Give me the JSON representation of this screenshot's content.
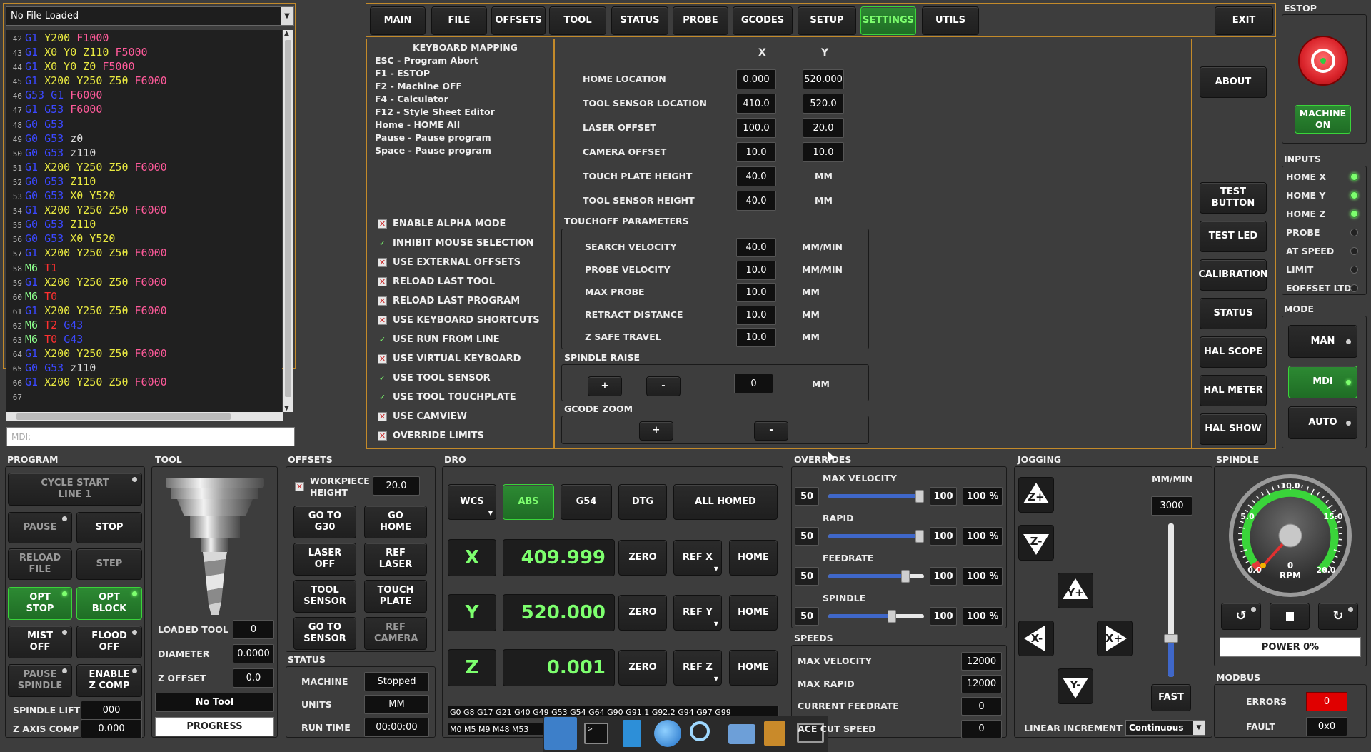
{
  "file": {
    "name": "No File Loaded",
    "mdi_placeholder": "MDI:"
  },
  "gcode": [
    {
      "n": "42",
      "t": [
        [
          "G1",
          "B"
        ],
        [
          " Y200 ",
          "Y"
        ],
        [
          "F1000",
          "P"
        ]
      ]
    },
    {
      "n": "43",
      "t": [
        [
          "G1",
          "B"
        ],
        [
          " X0 Y0 Z110 ",
          "Y"
        ],
        [
          "F5000",
          "P"
        ]
      ]
    },
    {
      "n": "44",
      "t": [
        [
          "G1",
          "B"
        ],
        [
          " X0 Y0 Z0 ",
          "Y"
        ],
        [
          "F5000",
          "P"
        ]
      ]
    },
    {
      "n": "45",
      "t": [
        [
          "G1",
          "B"
        ],
        [
          " X200 Y250 Z50 ",
          "Y"
        ],
        [
          "F6000",
          "P"
        ]
      ]
    },
    {
      "n": "46",
      "t": [
        [
          "G53 G1",
          "B"
        ],
        [
          " ",
          "W"
        ],
        [
          "F6000",
          "P"
        ]
      ]
    },
    {
      "n": "47",
      "t": [
        [
          "G1 G53",
          "B"
        ],
        [
          " ",
          "W"
        ],
        [
          "F6000",
          "P"
        ]
      ]
    },
    {
      "n": "48",
      "t": [
        [
          "G0 G53",
          "B"
        ]
      ]
    },
    {
      "n": "49",
      "t": [
        [
          "G0 G53",
          "B"
        ],
        [
          " z0",
          "W"
        ]
      ]
    },
    {
      "n": "50",
      "t": [
        [
          "G0 G53",
          "B"
        ],
        [
          " z110",
          "W"
        ]
      ]
    },
    {
      "n": "51",
      "t": [
        [
          "G1",
          "B"
        ],
        [
          " X200 Y250 Z50 ",
          "Y"
        ],
        [
          "F6000",
          "P"
        ]
      ]
    },
    {
      "n": "52",
      "t": [
        [
          "G0 G53",
          "B"
        ],
        [
          " Z110",
          "Y"
        ]
      ]
    },
    {
      "n": "53",
      "t": [
        [
          "G0 G53",
          "B"
        ],
        [
          " X0 Y520",
          "Y"
        ]
      ]
    },
    {
      "n": "54",
      "t": [
        [
          "G1",
          "B"
        ],
        [
          " X200 Y250 Z50 ",
          "Y"
        ],
        [
          "F6000",
          "P"
        ]
      ]
    },
    {
      "n": "55",
      "t": [
        [
          "G0 G53",
          "B"
        ],
        [
          " Z110",
          "Y"
        ]
      ]
    },
    {
      "n": "56",
      "t": [
        [
          "G0 G53",
          "B"
        ],
        [
          " X0 Y520",
          "Y"
        ]
      ]
    },
    {
      "n": "57",
      "t": [
        [
          "G1",
          "B"
        ],
        [
          " X200 Y250 Z50 ",
          "Y"
        ],
        [
          "F6000",
          "P"
        ]
      ]
    },
    {
      "n": "58",
      "t": [
        [
          "M6",
          "G"
        ],
        [
          " T1",
          "R"
        ]
      ]
    },
    {
      "n": "59",
      "t": [
        [
          "G1",
          "B"
        ],
        [
          " X200 Y250 Z50 ",
          "Y"
        ],
        [
          "F6000",
          "P"
        ]
      ]
    },
    {
      "n": "60",
      "t": [
        [
          "M6",
          "G"
        ],
        [
          " T0",
          "R"
        ]
      ]
    },
    {
      "n": "61",
      "t": [
        [
          "G1",
          "B"
        ],
        [
          " X200 Y250 Z50 ",
          "Y"
        ],
        [
          "F6000",
          "P"
        ]
      ]
    },
    {
      "n": "62",
      "t": [
        [
          "M6",
          "G"
        ],
        [
          " T2 ",
          "R"
        ],
        [
          "G43",
          "B"
        ]
      ]
    },
    {
      "n": "63",
      "t": [
        [
          "M6",
          "G"
        ],
        [
          " T0 ",
          "R"
        ],
        [
          "G43",
          "B"
        ]
      ]
    },
    {
      "n": "64",
      "t": [
        [
          "G1",
          "B"
        ],
        [
          " X200 Y250 Z50 ",
          "Y"
        ],
        [
          "F6000",
          "P"
        ]
      ]
    },
    {
      "n": "65",
      "t": [
        [
          "G0 G53",
          "B"
        ],
        [
          " z110",
          "W"
        ]
      ]
    },
    {
      "n": "66",
      "t": [
        [
          "G1",
          "B"
        ],
        [
          " X200 Y250 Z50 ",
          "Y"
        ],
        [
          "F6000",
          "P"
        ]
      ]
    },
    {
      "n": "67",
      "t": []
    }
  ],
  "tabs": [
    "MAIN",
    "FILE",
    "OFFSETS",
    "TOOL",
    "STATUS",
    "PROBE",
    "GCODES",
    "SETUP",
    "SETTINGS",
    "UTILS"
  ],
  "active_tab": "SETTINGS",
  "exit_label": "EXIT",
  "estop": {
    "title": "ESTOP",
    "machine_label": "MACHINE ON"
  },
  "keyboard": {
    "title": "KEYBOARD MAPPING",
    "items": [
      "ESC - Program Abort",
      "F1 - ESTOP",
      "F2 - Machine OFF",
      "F4 - Calculator",
      "F12 - Style Sheet Editor",
      "Home - HOME All",
      "Pause - Pause program",
      "Space - Pause program"
    ]
  },
  "options": [
    {
      "label": "ENABLE ALPHA MODE",
      "state": "x"
    },
    {
      "label": "INHIBIT MOUSE SELECTION",
      "state": "ok"
    },
    {
      "label": "USE EXTERNAL OFFSETS",
      "state": "x"
    },
    {
      "label": "RELOAD LAST TOOL",
      "state": "x"
    },
    {
      "label": "RELOAD LAST PROGRAM",
      "state": "x"
    },
    {
      "label": "USE KEYBOARD SHORTCUTS",
      "state": "x"
    },
    {
      "label": "USE RUN FROM LINE",
      "state": "ok"
    },
    {
      "label": "USE VIRTUAL KEYBOARD",
      "state": "x"
    },
    {
      "label": "USE TOOL SENSOR",
      "state": "ok"
    },
    {
      "label": "USE TOOL TOUCHPLATE",
      "state": "ok"
    },
    {
      "label": "USE CAMVIEW",
      "state": "x"
    },
    {
      "label": "OVERRIDE LIMITS",
      "state": "x"
    }
  ],
  "locations": {
    "x_header": "X",
    "y_header": "Y",
    "rows": [
      {
        "label": "HOME LOCATION",
        "x": "0.000",
        "y": "520.000"
      },
      {
        "label": "TOOL SENSOR LOCATION",
        "x": "410.0",
        "y": "520.0"
      },
      {
        "label": "LASER OFFSET",
        "x": "100.0",
        "y": "20.0"
      },
      {
        "label": "CAMERA OFFSET",
        "x": "10.0",
        "y": "10.0"
      },
      {
        "label": "TOUCH PLATE HEIGHT",
        "x": "40.0",
        "y": "MM"
      },
      {
        "label": "TOOL SENSOR HEIGHT",
        "x": "40.0",
        "y": "MM"
      }
    ]
  },
  "touchoff": {
    "title": "TOUCHOFF PARAMETERS",
    "rows": [
      {
        "label": "SEARCH VELOCITY",
        "value": "40.0",
        "unit": "MM/MIN"
      },
      {
        "label": "PROBE VELOCITY",
        "value": "10.0",
        "unit": "MM/MIN"
      },
      {
        "label": "MAX PROBE",
        "value": "10.0",
        "unit": "MM"
      },
      {
        "label": "RETRACT DISTANCE",
        "value": "10.0",
        "unit": "MM"
      },
      {
        "label": "Z SAFE TRAVEL",
        "value": "10.0",
        "unit": "MM"
      }
    ]
  },
  "spindle_raise": {
    "title": "SPINDLE RAISE",
    "plus": "+",
    "minus": "-",
    "value": "0",
    "unit": "MM"
  },
  "gcode_zoom": {
    "title": "GCODE ZOOM",
    "plus": "+",
    "minus": "-"
  },
  "side_buttons": [
    "ABOUT",
    "TEST BUTTON",
    "TEST LED",
    "CALIBRATION",
    "STATUS",
    "HAL SCOPE",
    "HAL METER",
    "HAL SHOW"
  ],
  "inputs": {
    "title": "INPUTS",
    "items": [
      {
        "label": "HOME X",
        "on": true
      },
      {
        "label": "HOME Y",
        "on": true
      },
      {
        "label": "HOME Z",
        "on": true
      },
      {
        "label": "PROBE",
        "on": false
      },
      {
        "label": "AT SPEED",
        "on": false
      },
      {
        "label": "LIMIT",
        "on": false
      },
      {
        "label": "EOFFSET LTD",
        "on": false
      }
    ]
  },
  "mode": {
    "title": "MODE",
    "items": [
      {
        "label": "MAN",
        "active": false
      },
      {
        "label": "MDI",
        "active": true
      },
      {
        "label": "AUTO",
        "active": false
      }
    ]
  },
  "program": {
    "title": "PROGRAM",
    "cycle_start": "CYCLE START",
    "cycle_line": "LINE 1",
    "pause": "PAUSE",
    "stop": "STOP",
    "reload": "RELOAD FILE",
    "step": "STEP",
    "opt_stop": "OPT STOP",
    "opt_block": "OPT BLOCK",
    "mist": "MIST OFF",
    "flood": "FLOOD OFF",
    "pause_spindle": "PAUSE SPINDLE",
    "enable_zcomp": "ENABLE Z COMP",
    "spindle_lift_label": "SPINDLE LIFT",
    "spindle_lift": "000",
    "zaxis_comp_label": "Z AXIS COMP",
    "zaxis_comp": "0.000"
  },
  "tool": {
    "title": "TOOL",
    "loaded_label": "LOADED TOOL",
    "loaded": "0",
    "diameter_label": "DIAMETER",
    "diameter": "0.0000",
    "zoffset_label": "Z OFFSET",
    "zoffset": "0.0",
    "name": "No Tool",
    "progress": "PROGRESS"
  },
  "offsets": {
    "title": "OFFSETS",
    "wp_label": "WORKPIECE HEIGHT",
    "wp": "20.0",
    "b1": "GO TO G30",
    "b2": "GO HOME",
    "b3": "LASER OFF",
    "b4": "REF LASER",
    "b5": "TOOL SENSOR",
    "b6": "TOUCH PLATE",
    "b7": "GO TO SENSOR",
    "b8": "REF CAMERA"
  },
  "status": {
    "title": "STATUS",
    "machine_label": "MACHINE",
    "machine": "Stopped",
    "units_label": "UNITS",
    "units": "MM",
    "runtime_label": "RUN TIME",
    "runtime": "00:00:00"
  },
  "dro": {
    "title": "DRO",
    "wcs": "WCS",
    "abs": "ABS",
    "g54": "G54",
    "dtg": "DTG",
    "all_homed": "ALL HOMED",
    "axes": [
      {
        "axis": "X",
        "value": "409.999",
        "ref": "REF X"
      },
      {
        "axis": "Y",
        "value": "520.000",
        "ref": "REF Y"
      },
      {
        "axis": "Z",
        "value": "0.001",
        "ref": "REF Z"
      }
    ],
    "zero": "ZERO",
    "home": "HOME",
    "gcodes_active": "G0 G8 G17 G21 G40 G49 G53 G54 G64 G90 G91.1 G92.2 G94 G97 G99",
    "mcodes_active": "M0 M5 M9 M48 M53"
  },
  "overrides": {
    "title": "OVERRIDES",
    "items": [
      {
        "label": "MAX VELOCITY",
        "min": "50",
        "max": "100",
        "pct": "100 %",
        "frac": 1.0
      },
      {
        "label": "RAPID",
        "min": "50",
        "max": "100",
        "pct": "100 %",
        "frac": 1.0
      },
      {
        "label": "FEEDRATE",
        "min": "50",
        "max": "100",
        "pct": "100 %",
        "frac": 0.84
      },
      {
        "label": "SPINDLE",
        "min": "50",
        "max": "100",
        "pct": "100 %",
        "frac": 0.68
      }
    ]
  },
  "speeds": {
    "title": "SPEEDS",
    "items": [
      {
        "label": "MAX VELOCITY",
        "value": "12000"
      },
      {
        "label": "MAX RAPID",
        "value": "12000"
      },
      {
        "label": "CURRENT FEEDRATE",
        "value": "0"
      },
      {
        "label": "ACE CUT SPEED",
        "value": "0"
      }
    ]
  },
  "jogging": {
    "title": "JOGGING",
    "units": "MM/MIN",
    "rate": "3000",
    "fast": "FAST",
    "increment_label": "LINEAR INCREMENT",
    "increment": "Continuous",
    "slider_frac": 0.25
  },
  "spindle": {
    "title": "SPINDLE",
    "rpm": "RPM",
    "rpm_value": "0",
    "ticks": [
      "0.0",
      "5.0",
      "10.0",
      "15.0",
      "20.0"
    ],
    "power": "POWER 0%"
  },
  "modbus": {
    "title": "MODBUS",
    "errors_label": "ERRORS",
    "errors": "0",
    "fault_label": "FAULT",
    "fault": "0x0"
  }
}
